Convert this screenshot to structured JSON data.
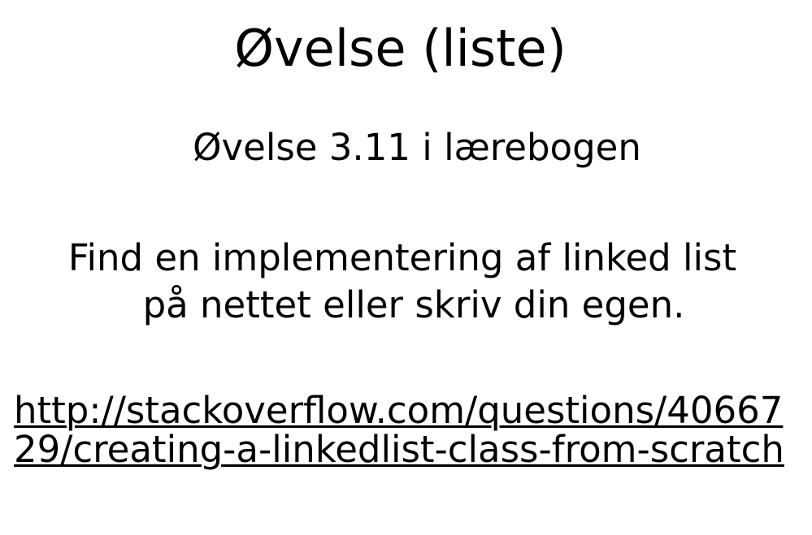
{
  "slide": {
    "title": "Øvelse (liste)",
    "subtitle": "Øvelse 3.11 i lærebogen",
    "instruction_line1": "Find en implementering af linked list",
    "instruction_line2": "på nettet eller skriv din egen.",
    "link_text": "http://stackoverflow.com/questions/4066729/creating-a-linkedlist-class-from-scratch",
    "link_href": "http://stackoverflow.com/questions/4066729/creating-a-linkedlist-class-from-scratch"
  }
}
